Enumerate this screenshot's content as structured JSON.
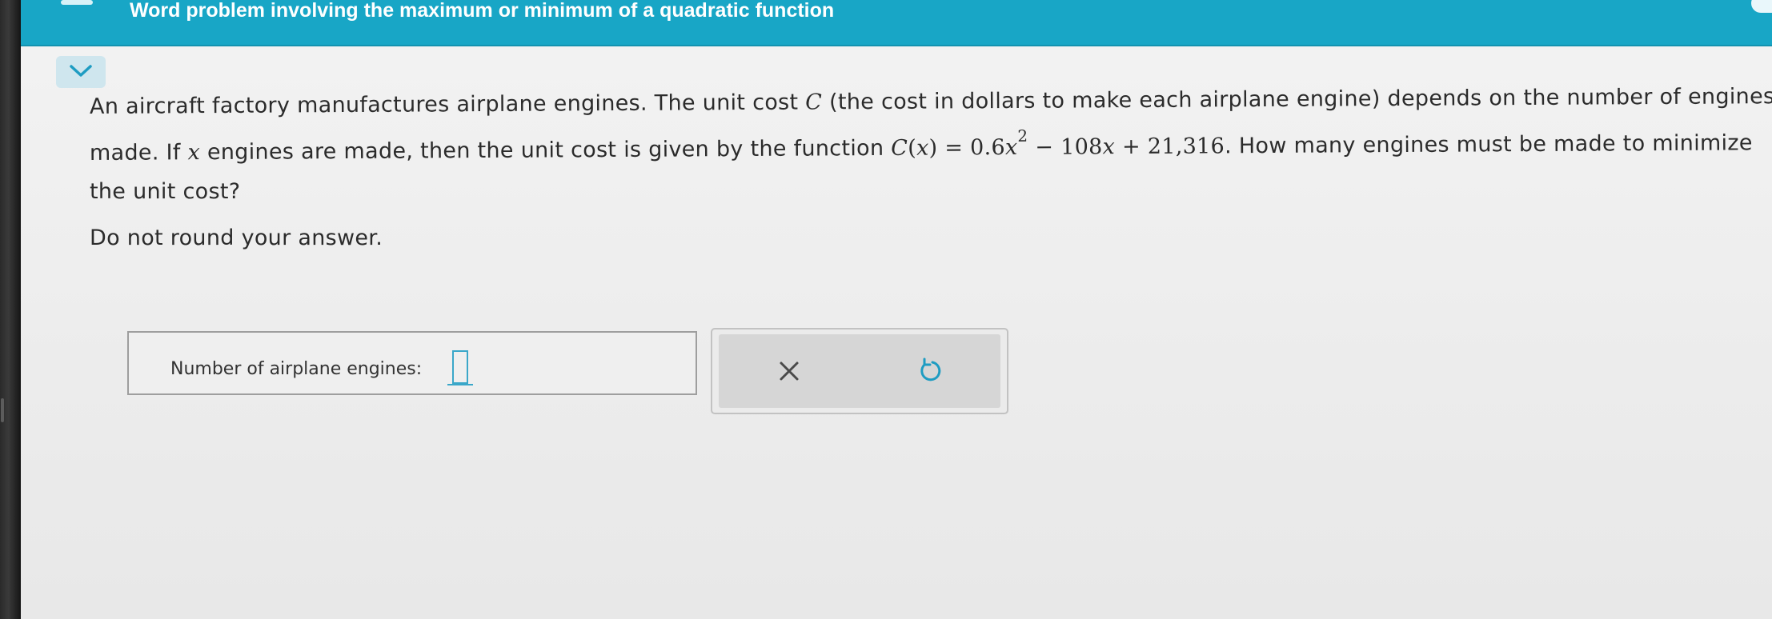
{
  "header": {
    "title": "Word problem involving the maximum or minimum of a quadratic function"
  },
  "problem": {
    "line1_a": "An aircraft factory manufactures airplane engines. The unit cost ",
    "line1_var": "C",
    "line1_b": " (the cost in dollars to make each airplane engine) depends on the number of engines",
    "line2_a": "made. If ",
    "line2_var": "x",
    "line2_b": " engines are made, then the unit cost is given by the function ",
    "func_name": "C",
    "func_arg": "x",
    "eq": " = 0.6",
    "term_var": "x",
    "exponent": "2",
    "rest_a": " − 108",
    "rest_var": "x",
    "rest_b": " + 21,316",
    "line2_c": ". How many engines must be made to minimize",
    "line3": "the unit cost?",
    "instruction": "Do not round your answer."
  },
  "answer": {
    "label": "Number of airplane engines:",
    "value": ""
  },
  "actions": {
    "clear_icon": "x-icon",
    "undo_icon": "undo-icon"
  },
  "colors": {
    "header_bg": "#18a6c6",
    "accent": "#3aa7c9"
  }
}
